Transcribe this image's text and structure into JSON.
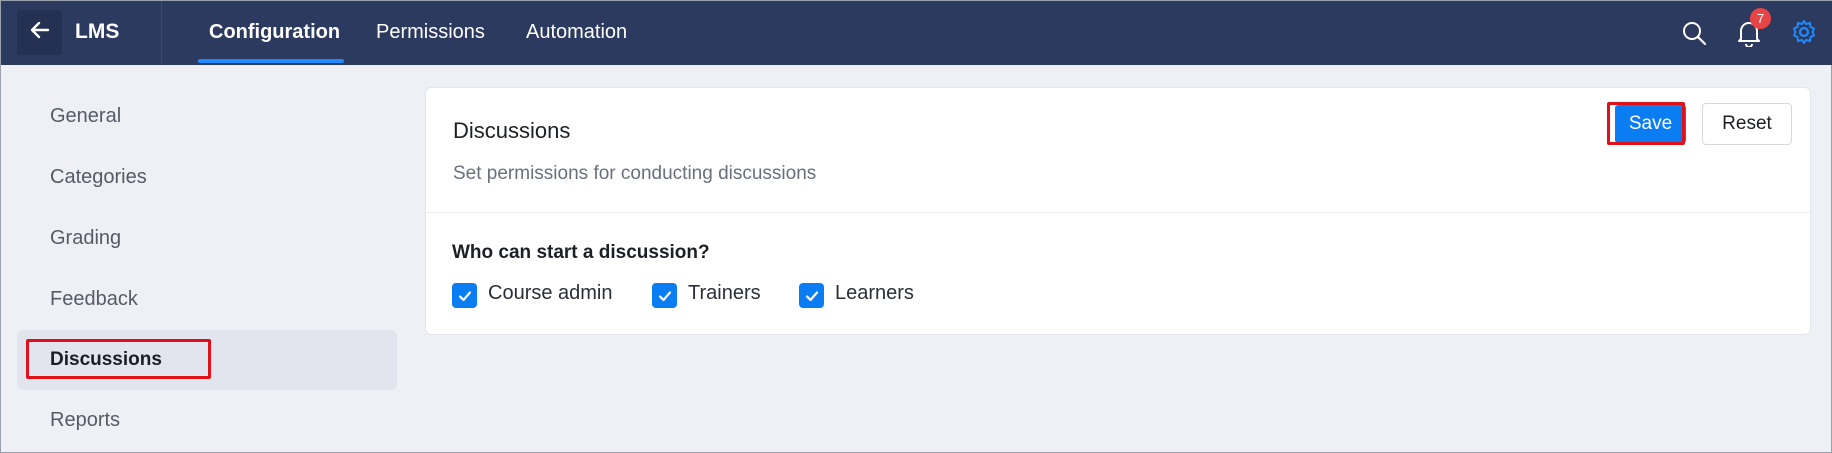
{
  "header": {
    "back_icon": "arrow-left-icon",
    "app_title": "LMS",
    "tabs": [
      {
        "label": "Configuration",
        "active": true
      },
      {
        "label": "Permissions",
        "active": false
      },
      {
        "label": "Automation",
        "active": false
      }
    ],
    "icons": [
      "search-icon",
      "bell-icon",
      "gear-icon"
    ],
    "notification_count": "7"
  },
  "sidebar": {
    "items": [
      {
        "label": "General",
        "active": false
      },
      {
        "label": "Categories",
        "active": false
      },
      {
        "label": "Grading",
        "active": false
      },
      {
        "label": "Feedback",
        "active": false
      },
      {
        "label": "Discussions",
        "active": true
      },
      {
        "label": "Reports",
        "active": false
      }
    ]
  },
  "card": {
    "title": "Discussions",
    "subtitle": "Set permissions for conducting discussions",
    "save_label": "Save",
    "reset_label": "Reset",
    "question": "Who can start a discussion?",
    "options": [
      {
        "label": "Course admin",
        "checked": true
      },
      {
        "label": "Trainers",
        "checked": true
      },
      {
        "label": "Learners",
        "checked": true
      }
    ]
  },
  "colors": {
    "topbar": "#2c3a5f",
    "accent": "#0b7df2",
    "highlight": "#e0111a",
    "badge": "#e64545"
  }
}
